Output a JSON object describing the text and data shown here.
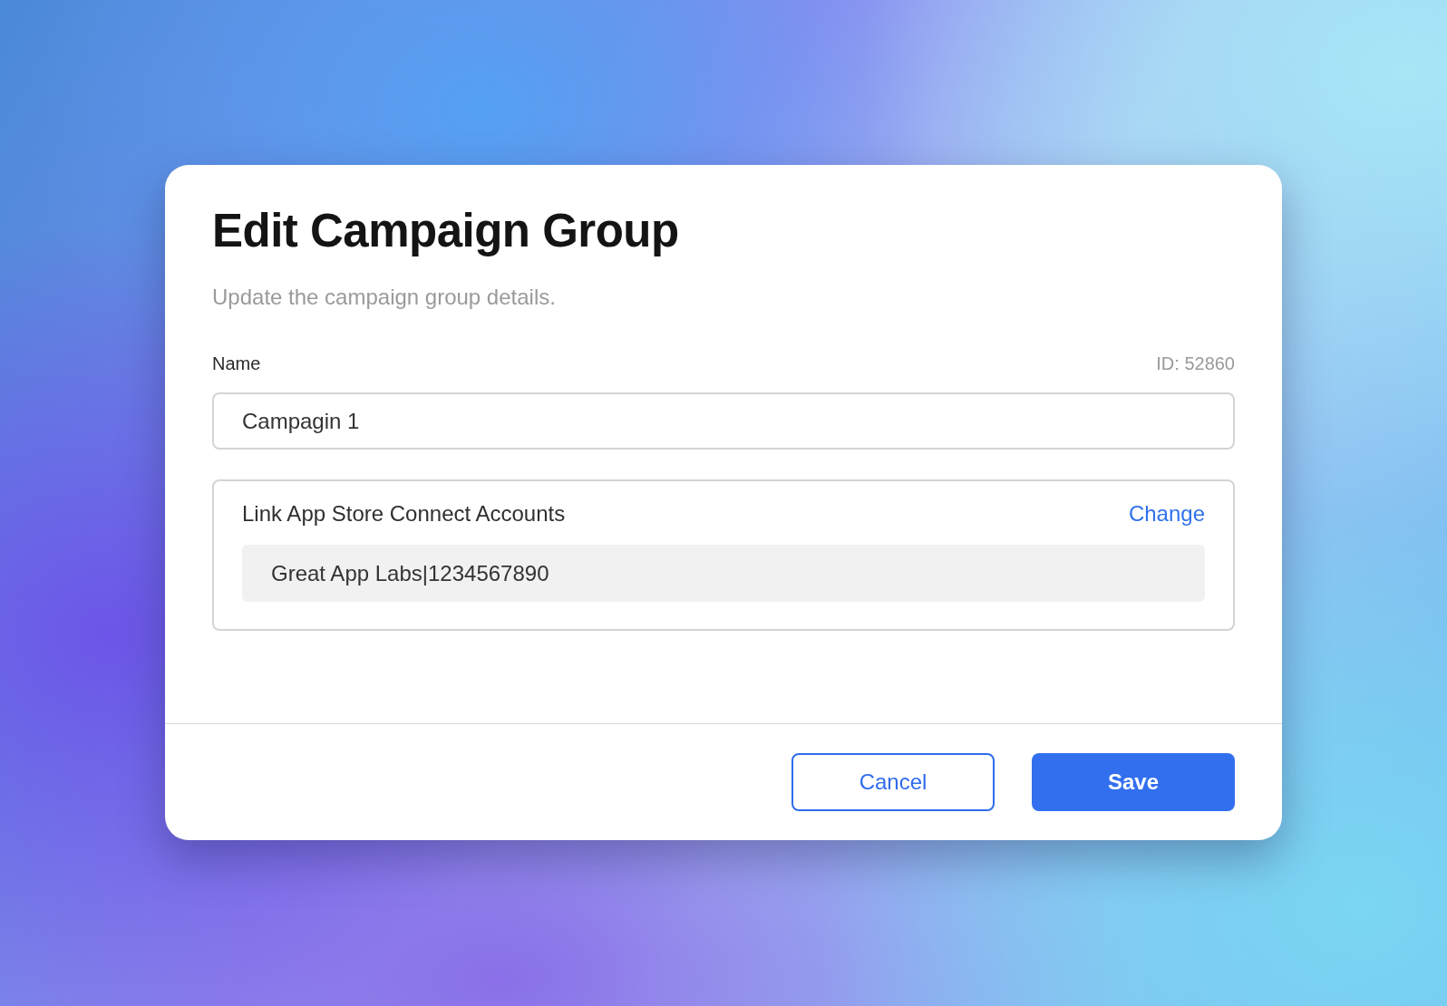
{
  "dialog": {
    "title": "Edit Campaign Group",
    "subtitle": "Update the campaign group details.",
    "name_field": {
      "label": "Name",
      "id_text": "ID: 52860",
      "value": "Campagin 1"
    },
    "linked_accounts": {
      "title": "Link App Store Connect Accounts",
      "action": "Change",
      "account": "Great App Labs|1234567890"
    },
    "buttons": [
      {
        "label": "Cancel",
        "kind": "secondary"
      },
      {
        "label": "Save",
        "kind": "primary"
      }
    ]
  }
}
